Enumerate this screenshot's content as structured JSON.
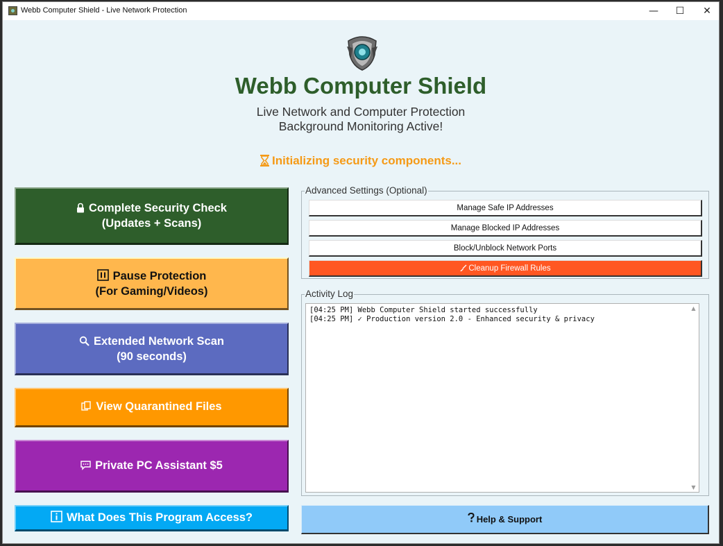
{
  "window": {
    "title": "Webb Computer Shield - Live Network Protection",
    "controls": {
      "minimize": "—",
      "maximize": "☐",
      "close": "✕"
    }
  },
  "header": {
    "app_title": "Webb Computer Shield",
    "subtitle_line1": "Live Network and Computer Protection",
    "subtitle_line2": "Background Monitoring Active!",
    "status": "Initializing security components...",
    "status_icon": "hourglass-icon"
  },
  "actions": {
    "security_check": {
      "line1": "Complete Security Check",
      "line2": "(Updates + Scans)",
      "icon": "lock-icon"
    },
    "pause_protection": {
      "line1": "Pause Protection",
      "line2": "(For Gaming/Videos)",
      "icon": "pause-icon"
    },
    "network_scan": {
      "line1": "Extended Network Scan",
      "line2": "(90 seconds)",
      "icon": "magnifier-icon"
    },
    "quarantine": {
      "label": "View Quarantined Files",
      "icon": "files-icon"
    },
    "assistant": {
      "label": "Private PC Assistant $5",
      "icon": "chat-icon"
    },
    "access_info": {
      "label": "What Does This Program Access?",
      "icon": "info-icon"
    }
  },
  "advanced": {
    "label": "Advanced Settings (Optional)",
    "buttons": [
      "Manage Safe IP Addresses",
      "Manage Blocked IP Addresses",
      "Block/Unblock Network Ports",
      "Cleanup Firewall Rules"
    ]
  },
  "activity_log": {
    "label": "Activity Log",
    "lines": [
      "[04:25 PM] Webb Computer Shield started successfully",
      "[04:25 PM] ✓ Production version 2.0 - Enhanced security & privacy"
    ]
  },
  "help": {
    "label": "Help & Support",
    "icon": "question-icon"
  },
  "colors": {
    "title_green": "#2e5e2b",
    "status_orange": "#f59a16",
    "security_button": "#2e5e2b",
    "pause_button": "#ffb74d",
    "scan_button": "#5c6bc0",
    "quarantine_button": "#ff9800",
    "assistant_button": "#9c27b0",
    "access_button": "#03a9f4",
    "cleanup_button": "#ff5722",
    "help_button": "#90caf9"
  }
}
